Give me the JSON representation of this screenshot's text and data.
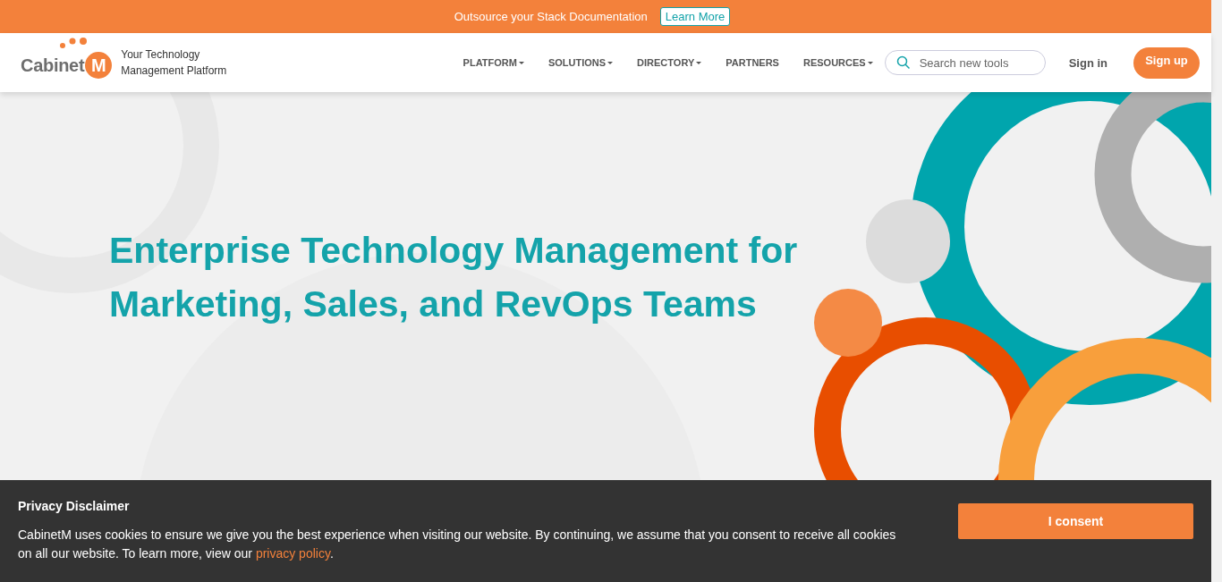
{
  "announcement": {
    "text": "Outsource your Stack Documentation",
    "link": "Learn More"
  },
  "header": {
    "logo": {
      "name": "Cabinet",
      "mark": "M"
    },
    "tagline_lines": [
      "Your Technology",
      "Management Platform"
    ],
    "nav": [
      {
        "label": "PLATFORM",
        "dropdown": true
      },
      {
        "label": "SOLUTIONS",
        "dropdown": true
      },
      {
        "label": "DIRECTORY",
        "dropdown": true
      },
      {
        "label": "PARTNERS",
        "dropdown": false
      },
      {
        "label": "RESOURCES",
        "dropdown": true
      }
    ],
    "search": {
      "placeholder": "Search new tools"
    },
    "sign_in": "Sign in",
    "sign_up": "Sign up"
  },
  "hero": {
    "title_lines": [
      "Enterprise Technology Management for",
      "Marketing, Sales, and RevOps Teams"
    ]
  },
  "cookie_banner": {
    "title": "Privacy Disclaimer",
    "text": "CabinetM uses cookies to ensure we give you the best experience when visiting our website. By continuing, we assume that you consent to receive all cookies on all our website. To learn more, view our",
    "link": "privacy policy",
    "after_link": ".",
    "button": "I consent"
  }
}
